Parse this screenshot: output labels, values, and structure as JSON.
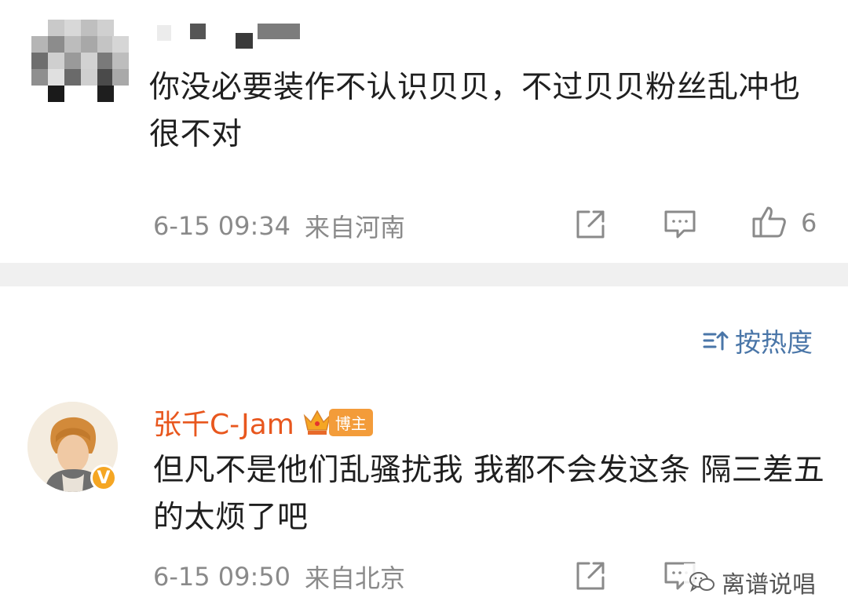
{
  "comments": [
    {
      "text": "你没必要装作不认识贝贝，不过贝贝粉丝乱冲也很不对",
      "date": "6-15 09:34",
      "location": "来自河南",
      "like_count": "6"
    },
    {
      "username": "张千C-Jam",
      "badge": "博主",
      "text": "但凡不是他们乱骚扰我 我都不会发这条 隔三差五的太烦了吧",
      "date": "6-15 09:50",
      "location": "来自北京"
    }
  ],
  "sort": {
    "label": "按热度"
  },
  "watermark": {
    "text": "离谱说唱"
  },
  "colors": {
    "username": "#e8571e",
    "sort_link": "#4a76a8",
    "badge": "#f39c3a",
    "divider": "#f0f0f0",
    "meta_text": "#8a8a8a"
  },
  "icons": {
    "repost": "share-box-icon",
    "comment": "comment-bubble-icon",
    "like": "thumbs-up-icon",
    "sort": "sort-icon",
    "verified": "verified-v-icon",
    "crown": "crown-icon",
    "watermark": "wechat-icon"
  }
}
